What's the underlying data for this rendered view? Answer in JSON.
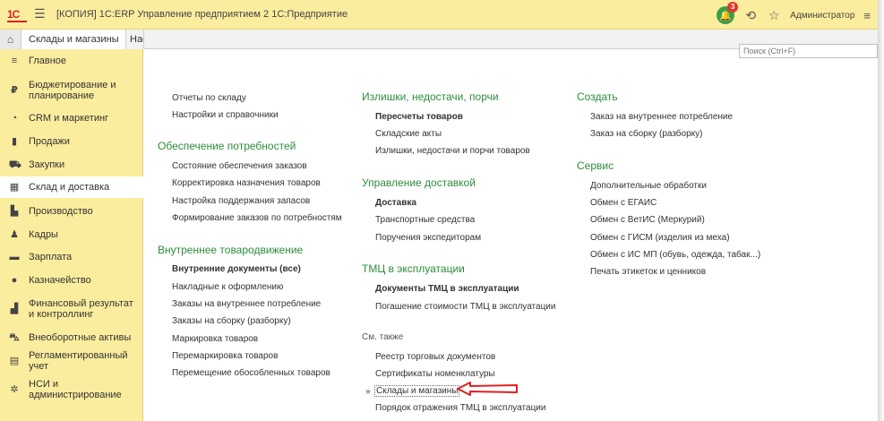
{
  "app": {
    "logo_text": "1C",
    "title": "[КОПИЯ] 1С:ERP Управление предприятием 2 1С:Предприятие",
    "notifications_count": "3",
    "user": "Администратор"
  },
  "tabs": [
    {
      "label": "Склады и магазины"
    },
    {
      "label": "Нас"
    }
  ],
  "sidebar": {
    "items": [
      {
        "label": "Главное",
        "icon": "list-icon"
      },
      {
        "label": "Бюджетирование и планирование",
        "icon": "budget-icon"
      },
      {
        "label": "CRM и маркетинг",
        "icon": "crm-icon"
      },
      {
        "label": "Продажи",
        "icon": "sales-icon"
      },
      {
        "label": "Закупки",
        "icon": "cart-icon"
      },
      {
        "label": "Склад и доставка",
        "icon": "warehouse-icon",
        "active": true
      },
      {
        "label": "Производство",
        "icon": "factory-icon"
      },
      {
        "label": "Кадры",
        "icon": "person-icon"
      },
      {
        "label": "Зарплата",
        "icon": "wallet-icon"
      },
      {
        "label": "Казначейство",
        "icon": "coin-icon"
      },
      {
        "label": "Финансовый результат и контроллинг",
        "icon": "chart-icon"
      },
      {
        "label": "Внеоборотные активы",
        "icon": "car-icon"
      },
      {
        "label": "Регламентированный учет",
        "icon": "calculator-icon"
      },
      {
        "label": "НСИ и администрирование",
        "icon": "gear-icon"
      }
    ]
  },
  "search": {
    "placeholder": "Поиск (Ctrl+F)"
  },
  "col1": {
    "top_links": [
      "Отчеты по складу",
      "Настройки и справочники"
    ],
    "section1": {
      "title": "Обеспечение потребностей",
      "links": [
        "Состояние обеспечения заказов",
        "Корректировка назначения товаров",
        "Настройка поддержания запасов",
        "Формирование заказов по потребностям"
      ]
    },
    "section2": {
      "title": "Внутреннее товародвижение",
      "links": [
        "Внутренние документы (все)",
        "Накладные к оформлению",
        "Заказы на внутреннее потребление",
        "Заказы на сборку (разборку)",
        "Маркировка товаров",
        "Перемаркировка товаров",
        "Перемещение обособленных товаров"
      ]
    }
  },
  "col2": {
    "section1": {
      "title": "Излишки, недостачи, порчи",
      "links": [
        "Пересчеты товаров",
        "Складские акты",
        "Излишки, недостачи и порчи товаров"
      ]
    },
    "section2": {
      "title": "Управление доставкой",
      "links": [
        "Доставка",
        "Транспортные средства",
        "Поручения экспедиторам"
      ]
    },
    "section3": {
      "title": "ТМЦ в эксплуатации",
      "links": [
        "Документы ТМЦ в эксплуатации",
        "Погашение стоимости ТМЦ в эксплуатации"
      ]
    },
    "see_also": {
      "title": "См. также",
      "links": [
        "Реестр торговых документов",
        "Сертификаты номенклатуры",
        "Склады и магазины",
        "Порядок отражения ТМЦ в эксплуатации"
      ]
    }
  },
  "col3": {
    "section1": {
      "title": "Создать",
      "links": [
        "Заказ на внутреннее потребление",
        "Заказ на сборку (разборку)"
      ]
    },
    "section2": {
      "title": "Сервис",
      "links": [
        "Дополнительные обработки",
        "Обмен с ЕГАИС",
        "Обмен с ВетИС (Меркурий)",
        "Обмен с ГИСМ (изделия из меха)",
        "Обмен с ИС МП (обувь, одежда, табак...)",
        "Печать этикеток и ценников"
      ]
    }
  },
  "colors": {
    "sidebar_bg": "#fbed9e",
    "heading_green": "#2d8c3c",
    "annotation_arrow": "#e02020"
  }
}
